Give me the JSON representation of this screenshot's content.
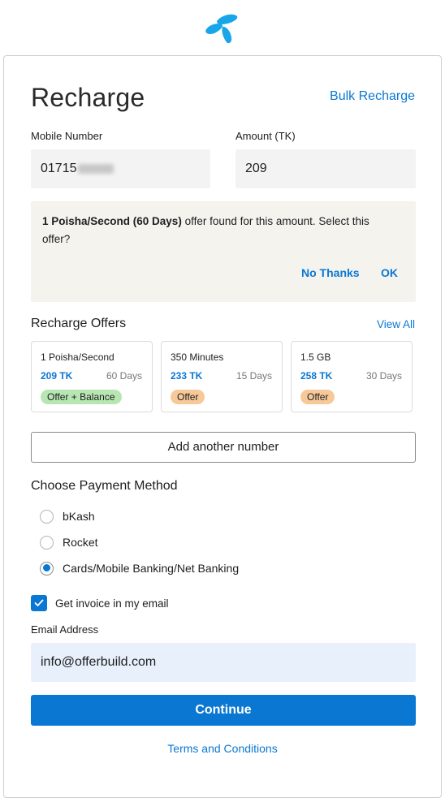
{
  "brand": {
    "logo_icon": "telenor-logo-icon",
    "accent_color": "#0a78d2"
  },
  "header": {
    "title": "Recharge",
    "bulk_recharge_link": "Bulk Recharge"
  },
  "form": {
    "mobile_label": "Mobile Number",
    "mobile_value": "01715",
    "mobile_value_note": "remaining digits blurred",
    "amount_label": "Amount (TK)",
    "amount_value": "209"
  },
  "notice": {
    "offer_highlight": "1 Poisha/Second (60 Days)",
    "message": " offer found for this amount. Select this offer?",
    "no_thanks_label": "No Thanks",
    "ok_label": "OK"
  },
  "offers": {
    "heading": "Recharge Offers",
    "view_all_label": "View All",
    "items": [
      {
        "name": "1 Poisha/Second",
        "price": "209 TK",
        "validity": "60 Days",
        "badge": "Offer + Balance",
        "badge_color": "#b7e6b3"
      },
      {
        "name": "350 Minutes",
        "price": "233 TK",
        "validity": "15 Days",
        "badge": "Offer",
        "badge_color": "#f7c999"
      },
      {
        "name": "1.5 GB",
        "price": "258 TK",
        "validity": "30 Days",
        "badge": "Offer",
        "badge_color": "#f7c999"
      }
    ]
  },
  "add_number_label": "Add another number",
  "payment": {
    "heading": "Choose Payment Method",
    "options": [
      {
        "label": "bKash",
        "selected": false
      },
      {
        "label": "Rocket",
        "selected": false
      },
      {
        "label": "Cards/Mobile Banking/Net Banking",
        "selected": true
      }
    ]
  },
  "invoice": {
    "label": "Get invoice in my email",
    "checked": true
  },
  "email": {
    "label": "Email Address",
    "value": "info@offerbuild.com"
  },
  "continue_label": "Continue",
  "terms_label": "Terms and Conditions"
}
